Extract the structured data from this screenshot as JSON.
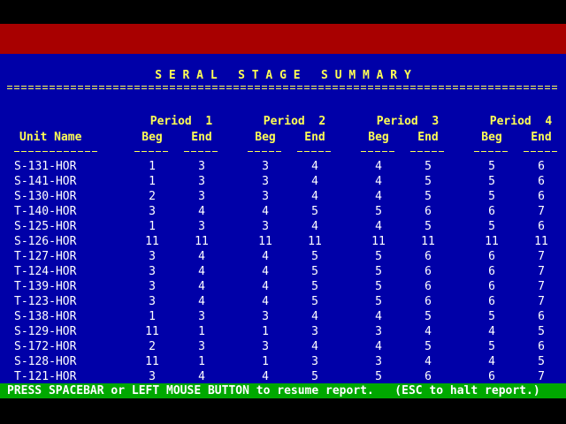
{
  "report": {
    "title": "S E R A L   S T A G E   S U M M A R Y",
    "unit_header": "Unit Name",
    "periods": [
      {
        "label": "Period  1",
        "beg": "Beg",
        "end": "End"
      },
      {
        "label": "Period  2",
        "beg": "Beg",
        "end": "End"
      },
      {
        "label": "Period  3",
        "beg": "Beg",
        "end": "End"
      },
      {
        "label": "Period  4",
        "beg": "Beg",
        "end": "End"
      }
    ],
    "rows": [
      {
        "unit": "S-131-HOR",
        "values": [
          "1",
          "3",
          "3",
          "4",
          "4",
          "5",
          "5",
          "6"
        ]
      },
      {
        "unit": "S-141-HOR",
        "values": [
          "1",
          "3",
          "3",
          "4",
          "4",
          "5",
          "5",
          "6"
        ]
      },
      {
        "unit": "S-130-HOR",
        "values": [
          "2",
          "3",
          "3",
          "4",
          "4",
          "5",
          "5",
          "6"
        ]
      },
      {
        "unit": "T-140-HOR",
        "values": [
          "3",
          "4",
          "4",
          "5",
          "5",
          "6",
          "6",
          "7"
        ]
      },
      {
        "unit": "S-125-HOR",
        "values": [
          "1",
          "3",
          "3",
          "4",
          "4",
          "5",
          "5",
          "6"
        ]
      },
      {
        "unit": "S-126-HOR",
        "values": [
          "11",
          "11",
          "11",
          "11",
          "11",
          "11",
          "11",
          "11"
        ]
      },
      {
        "unit": "T-127-HOR",
        "values": [
          "3",
          "4",
          "4",
          "5",
          "5",
          "6",
          "6",
          "7"
        ]
      },
      {
        "unit": "T-124-HOR",
        "values": [
          "3",
          "4",
          "4",
          "5",
          "5",
          "6",
          "6",
          "7"
        ]
      },
      {
        "unit": "T-139-HOR",
        "values": [
          "3",
          "4",
          "4",
          "5",
          "5",
          "6",
          "6",
          "7"
        ]
      },
      {
        "unit": "T-123-HOR",
        "values": [
          "3",
          "4",
          "4",
          "5",
          "5",
          "6",
          "6",
          "7"
        ]
      },
      {
        "unit": "S-138-HOR",
        "values": [
          "1",
          "3",
          "3",
          "4",
          "4",
          "5",
          "5",
          "6"
        ]
      },
      {
        "unit": "S-129-HOR",
        "values": [
          "11",
          "1",
          "1",
          "3",
          "3",
          "4",
          "4",
          "5"
        ]
      },
      {
        "unit": "S-172-HOR",
        "values": [
          "2",
          "3",
          "3",
          "4",
          "4",
          "5",
          "5",
          "6"
        ]
      },
      {
        "unit": "S-128-HOR",
        "values": [
          "11",
          "1",
          "1",
          "3",
          "3",
          "4",
          "4",
          "5"
        ]
      },
      {
        "unit": "T-121-HOR",
        "values": [
          "3",
          "4",
          "4",
          "5",
          "5",
          "6",
          "6",
          "7"
        ]
      }
    ]
  },
  "status_bar": {
    "message": "PRESS SPACEBAR or LEFT MOUSE BUTTON to resume report.   (ESC to halt report.)"
  },
  "colors": {
    "report_background": "#0000A8",
    "top_bar": "#A80000",
    "status_bar": "#00A800",
    "header_text": "#FFFF55",
    "data_text": "#FFFFFF"
  }
}
